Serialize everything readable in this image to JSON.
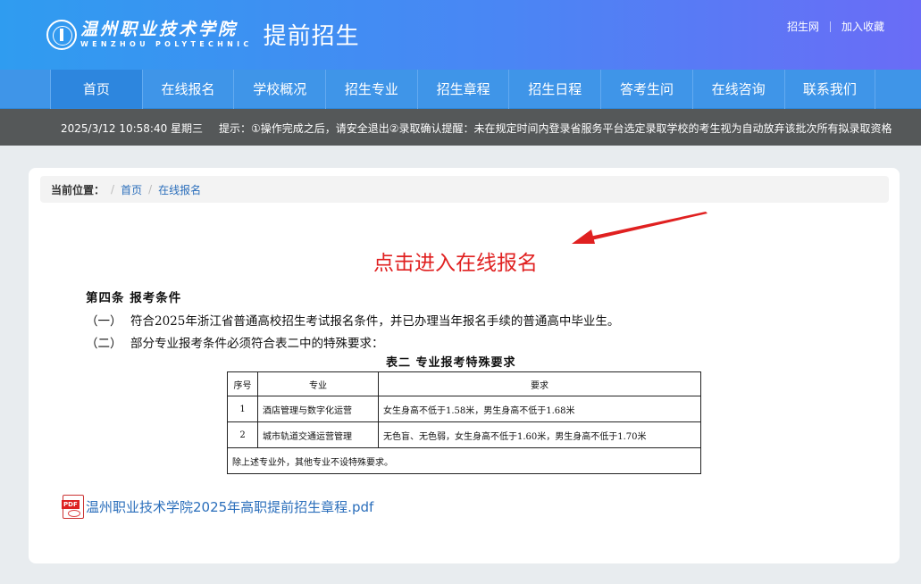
{
  "header": {
    "school_name_cn": "温州职业技术学院",
    "school_name_en": "WENZHOU POLYTECHNIC",
    "site_title": "提前招生",
    "links": [
      "招生网",
      "加入收藏"
    ]
  },
  "nav": {
    "items": [
      "首页",
      "在线报名",
      "学校概况",
      "招生专业",
      "招生章程",
      "招生日程",
      "答考生问",
      "在线咨询",
      "联系我们"
    ],
    "active": "首页"
  },
  "infobar": {
    "datetime": "2025/3/12 10:58:40 星期三",
    "notice": "提示：①操作完成之后，请安全退出②录取确认提醒：未在规定时间内登录省服务平台选定录取学校的考生视为自动放弃该批次所有拟录取资格"
  },
  "breadcrumb": {
    "label": "当前位置：",
    "items": [
      "首页",
      "在线报名"
    ]
  },
  "main": {
    "headline": "点击进入在线报名",
    "article_title": "第四条  报考条件",
    "conditions": [
      {
        "num": "（一）",
        "text": "符合2025年浙江省普通高校招生考试报名条件，并已办理当年报名手续的普通高中毕业生。"
      },
      {
        "num": "（二）",
        "text": "部分专业报考条件必须符合表二中的特殊要求："
      }
    ],
    "table": {
      "title": "表二    专业报考特殊要求",
      "headers": [
        "序号",
        "专业",
        "要求"
      ],
      "rows": [
        [
          "1",
          "酒店管理与数字化运营",
          "女生身高不低于1.58米，男生身高不低于1.68米"
        ],
        [
          "2",
          "城市轨道交通运营管理",
          "无色盲、无色弱，女生身高不低于1.60米，男生身高不低于1.70米"
        ]
      ],
      "footer": "除上述专业外，其他专业不设特殊要求。"
    },
    "pdf_link": "温州职业技术学院2025年高职提前招生章程.pdf"
  },
  "colors": {
    "header_start": "#2f9cf0",
    "header_end": "#6a6cf6",
    "nav": "#3f95e8",
    "infobar": "#555859",
    "headline": "#e02020",
    "link": "#2a6ebb"
  },
  "icons": [
    "school-seal-icon",
    "pdf-file-icon",
    "red-arrow"
  ]
}
